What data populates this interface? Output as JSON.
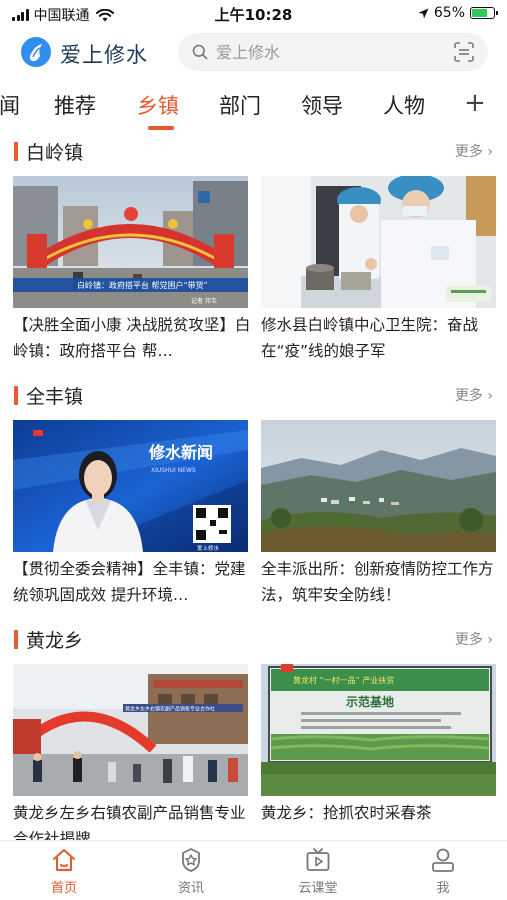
{
  "status_bar": {
    "carrier": "中国联通",
    "time": "上午10:28",
    "battery": "65%",
    "battery_level": 0.65
  },
  "header": {
    "app_title": "爱上修水",
    "search_placeholder": "爱上修水"
  },
  "tabs": [
    {
      "label": "闻",
      "active": false
    },
    {
      "label": "推荐",
      "active": false
    },
    {
      "label": "乡镇",
      "active": true
    },
    {
      "label": "部门",
      "active": false
    },
    {
      "label": "领导",
      "active": false
    },
    {
      "label": "人物",
      "active": false
    }
  ],
  "tab_add": "+",
  "sections": [
    {
      "title": "白岭镇",
      "more": "更多 ›",
      "items": [
        {
          "caption": "【决胜全面小康 决战脱贫攻坚】白岭镇：政府搭平台 帮…",
          "image_caption": "白岭镇：政府搭平台 帮党困户“带货”",
          "image_reporter": "记者 邓韦"
        },
        {
          "caption": "修水县白岭镇中心卫生院：奋战在“疫”线的娘子军",
          "image_caption": ""
        }
      ]
    },
    {
      "title": "全丰镇",
      "more": "更多 ›",
      "items": [
        {
          "caption": "【贯彻全委会精神】全丰镇：党建统领巩固成效 提升环境…",
          "image_caption": "修水新闻",
          "image_subcaption": "XIUSHUI NEWS",
          "image_tag": "爱上修水"
        },
        {
          "caption": "全丰派出所：创新疫情防控工作方法，筑牢安全防线！",
          "image_caption": ""
        }
      ]
    },
    {
      "title": "黄龙乡",
      "more": "更多 ›",
      "items": [
        {
          "caption": "黄龙乡左乡右镇农副产品销售专业合作社揭牌",
          "image_caption": "黄龙乡左乡右镇农副产品销售专业合作社"
        },
        {
          "caption": "黄龙乡：抢抓农时采春茶",
          "image_caption": "示范基地",
          "image_banner": "黄龙村 “一村一品” 产业扶贫"
        }
      ]
    }
  ],
  "bottom_nav": [
    {
      "label": "首页",
      "icon": "home-icon",
      "active": true
    },
    {
      "label": "资讯",
      "icon": "news-badge-icon",
      "active": false
    },
    {
      "label": "云课堂",
      "icon": "tv-play-icon",
      "active": false
    },
    {
      "label": "我",
      "icon": "person-icon",
      "active": false
    }
  ],
  "colors": {
    "accent": "#e8592c",
    "logo": "#2f8ef0"
  }
}
